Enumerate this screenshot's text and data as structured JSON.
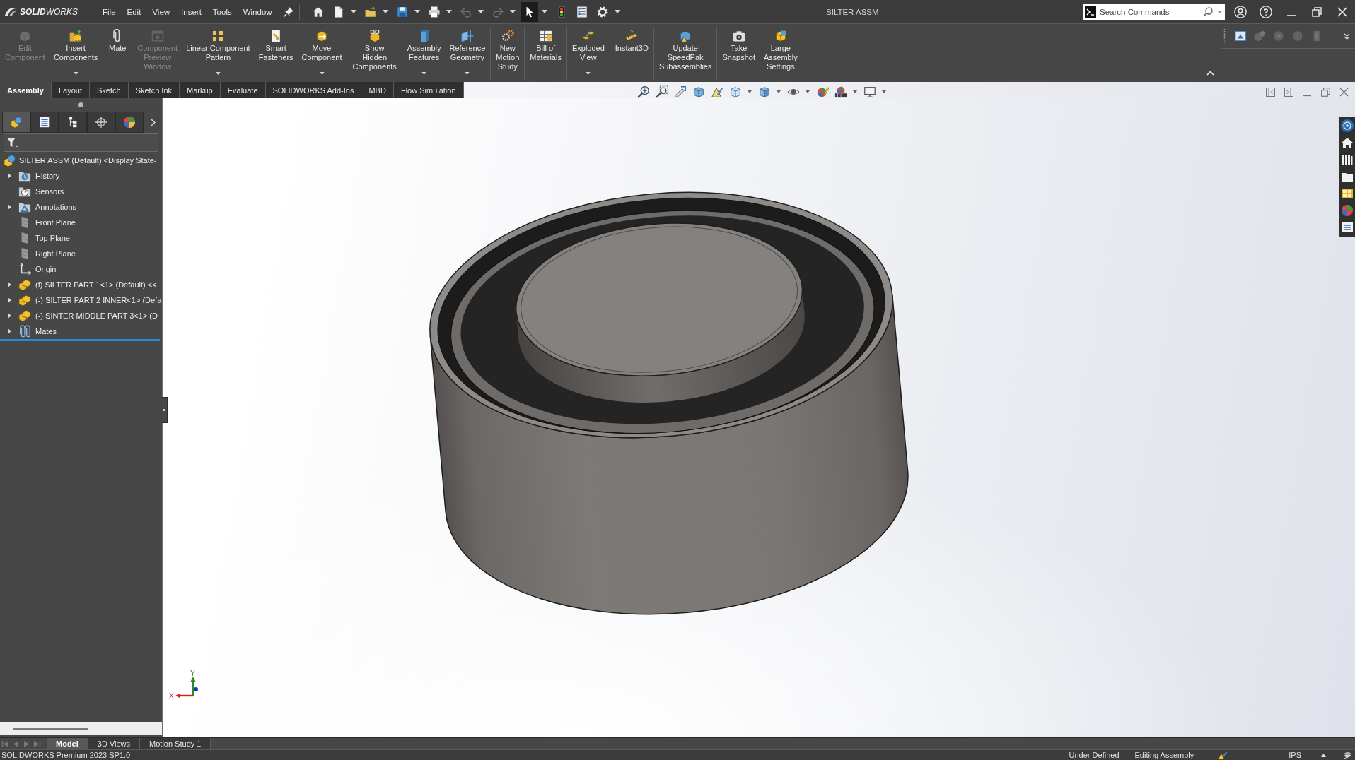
{
  "title_bar": {
    "logo": "**SOLID**WORKS",
    "menus": [
      "File",
      "Edit",
      "View",
      "Insert",
      "Tools",
      "Window"
    ],
    "quick_access": [
      {
        "menu": false,
        "disabled": false,
        "selected": false
      },
      {
        "menu": true,
        "disabled": false,
        "selected": false
      },
      {
        "menu": true,
        "disabled": false,
        "selected": false
      },
      {
        "menu": true,
        "disabled": false,
        "selected": false
      },
      {
        "menu": true,
        "disabled": false,
        "selected": false
      },
      {
        "menu": true,
        "disabled": true,
        "selected": false
      },
      {
        "menu": true,
        "disabled": true,
        "selected": false
      },
      {
        "menu": true,
        "disabled": false,
        "selected": true
      },
      {
        "menu": false,
        "disabled": false,
        "selected": false
      },
      {
        "menu": false,
        "disabled": false,
        "selected": false
      },
      {
        "menu": true,
        "disabled": false,
        "selected": false
      }
    ],
    "document_title": "SILTER ASSM",
    "search": {
      "placeholder": "Search Commands"
    }
  },
  "ribbon": {
    "groups": [
      [
        {
          "label": "Edit\nComponent",
          "disabled": true,
          "menu": false
        },
        {
          "label": "Insert\nComponents",
          "disabled": false,
          "menu": true
        },
        {
          "label": "Mate",
          "disabled": false,
          "menu": false
        },
        {
          "label": "Component\nPreview\nWindow",
          "disabled": true,
          "menu": false
        },
        {
          "label": "Linear Component\nPattern",
          "disabled": false,
          "menu": true
        },
        {
          "label": "Smart\nFasteners",
          "disabled": false,
          "menu": false
        },
        {
          "label": "Move\nComponent",
          "disabled": false,
          "menu": true
        }
      ],
      [
        {
          "label": "Show\nHidden\nComponents",
          "disabled": false,
          "menu": false
        }
      ],
      [
        {
          "label": "Assembly\nFeatures",
          "disabled": false,
          "menu": true
        },
        {
          "label": "Reference\nGeometry",
          "disabled": false,
          "menu": true
        }
      ],
      [
        {
          "label": "New\nMotion\nStudy",
          "disabled": false,
          "menu": false
        }
      ],
      [
        {
          "label": "Bill of\nMaterials",
          "disabled": false,
          "menu": false
        }
      ],
      [
        {
          "label": "Exploded\nView",
          "disabled": false,
          "menu": true
        }
      ],
      [
        {
          "label": "Instant3D",
          "disabled": false,
          "menu": false
        }
      ],
      [
        {
          "label": "Update\nSpeedPak\nSubassemblies",
          "disabled": false,
          "menu": false
        }
      ],
      [
        {
          "label": "Take\nSnapshot",
          "disabled": false,
          "menu": false
        },
        {
          "label": "Large\nAssembly\nSettings",
          "disabled": false,
          "menu": false
        }
      ]
    ],
    "view_tools": [
      {
        "disabled": false
      },
      {
        "disabled": true
      },
      {
        "disabled": true
      },
      {
        "disabled": true
      },
      {
        "disabled": true
      }
    ]
  },
  "command_tabs": [
    {
      "label": "Assembly",
      "selected": true
    },
    {
      "label": "Layout",
      "selected": false
    },
    {
      "label": "Sketch",
      "selected": false
    },
    {
      "label": "Sketch Ink",
      "selected": false
    },
    {
      "label": "Markup",
      "selected": false
    },
    {
      "label": "Evaluate",
      "selected": false
    },
    {
      "label": "SOLIDWORKS Add-Ins",
      "selected": false
    },
    {
      "label": "MBD",
      "selected": false
    },
    {
      "label": "Flow Simulation",
      "selected": false
    }
  ],
  "feature_manager": {
    "tabs": [
      {
        "selected": true
      },
      {
        "selected": false
      },
      {
        "selected": false
      },
      {
        "selected": false
      },
      {
        "selected": false
      }
    ],
    "tree": [
      {
        "label": "SILTER ASSM (Default) <Display State-",
        "kind": "assembly",
        "collapsed": false,
        "children": [
          {
            "label": "History",
            "kind": "history",
            "collapsed": true
          },
          {
            "label": "Sensors",
            "kind": "sensors",
            "collapsed": false
          },
          {
            "label": "Annotations",
            "kind": "annotations",
            "collapsed": true
          },
          {
            "label": "Front Plane",
            "kind": "plane",
            "collapsed": false
          },
          {
            "label": "Top Plane",
            "kind": "plane",
            "collapsed": false
          },
          {
            "label": "Right Plane",
            "kind": "plane",
            "collapsed": false
          },
          {
            "label": "Origin",
            "kind": "origin",
            "collapsed": false
          },
          {
            "label": "(f) SILTER PART 1<1> (Default) <<",
            "kind": "part",
            "collapsed": true
          },
          {
            "label": "(-) SILTER PART 2 INNER<1> (Defa",
            "kind": "part",
            "collapsed": true
          },
          {
            "label": "(-) SINTER MIDDLE PART 3<1> (D",
            "kind": "part",
            "collapsed": true
          },
          {
            "label": "Mates",
            "kind": "mates",
            "collapsed": true
          }
        ]
      }
    ]
  },
  "viewport": {
    "triad": {
      "x_label": "X",
      "y_label": "Y"
    }
  },
  "bottom_tabs": [
    {
      "label": "Model",
      "selected": true
    },
    {
      "label": "3D Views",
      "selected": false
    },
    {
      "label": "Motion Study 1",
      "selected": false
    }
  ],
  "status_bar": {
    "product": "SOLIDWORKS Premium 2023 SP1.0",
    "definition": "Under Defined",
    "mode": "Editing Assembly",
    "units": "IPS"
  }
}
